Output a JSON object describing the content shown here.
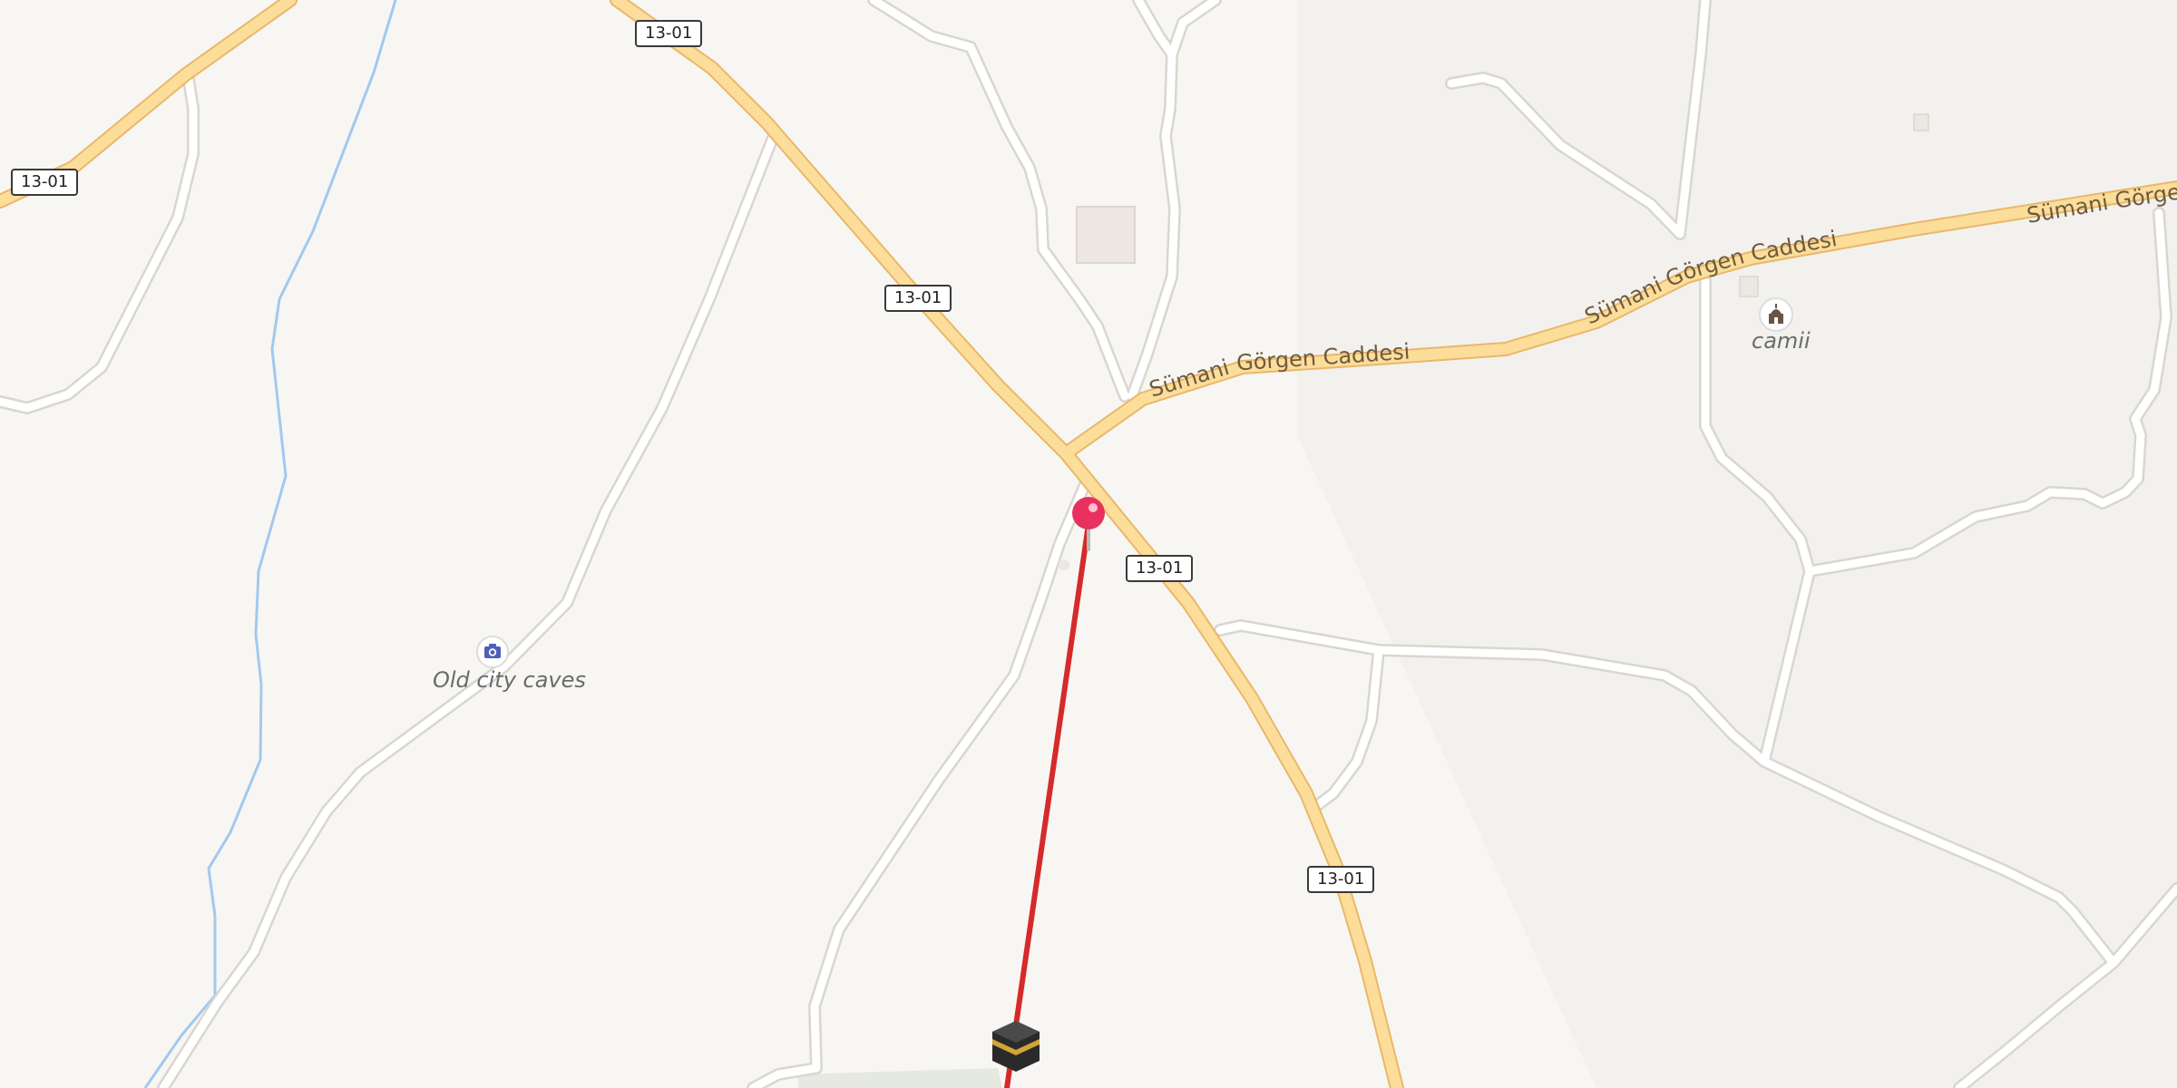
{
  "map": {
    "route_shields": [
      "13-01",
      "13-01",
      "13-01",
      "13-01",
      "13-01"
    ],
    "street_labels": {
      "primary": "Sümani Görgen Caddesi",
      "secondary": "Sümani Görgen Caddesi",
      "edge": "Sümani Görgen"
    },
    "pois": {
      "old_city_caves": "Old city caves",
      "camii": "camii"
    },
    "icons": {
      "pin": "map-pin-icon",
      "camera": "camera-icon",
      "mosque": "mosque-icon",
      "kaaba": "kaaba-icon"
    },
    "colors": {
      "background": "#f8f6f3",
      "main_road": "#fcdd9a",
      "main_road_casing": "#e8b86a",
      "minor_road": "#ffffff",
      "minor_road_casing": "#d9d6d2",
      "stream": "#a3c8ee",
      "qibla_line": "#d62a2a",
      "pin": "#e9315f"
    }
  }
}
